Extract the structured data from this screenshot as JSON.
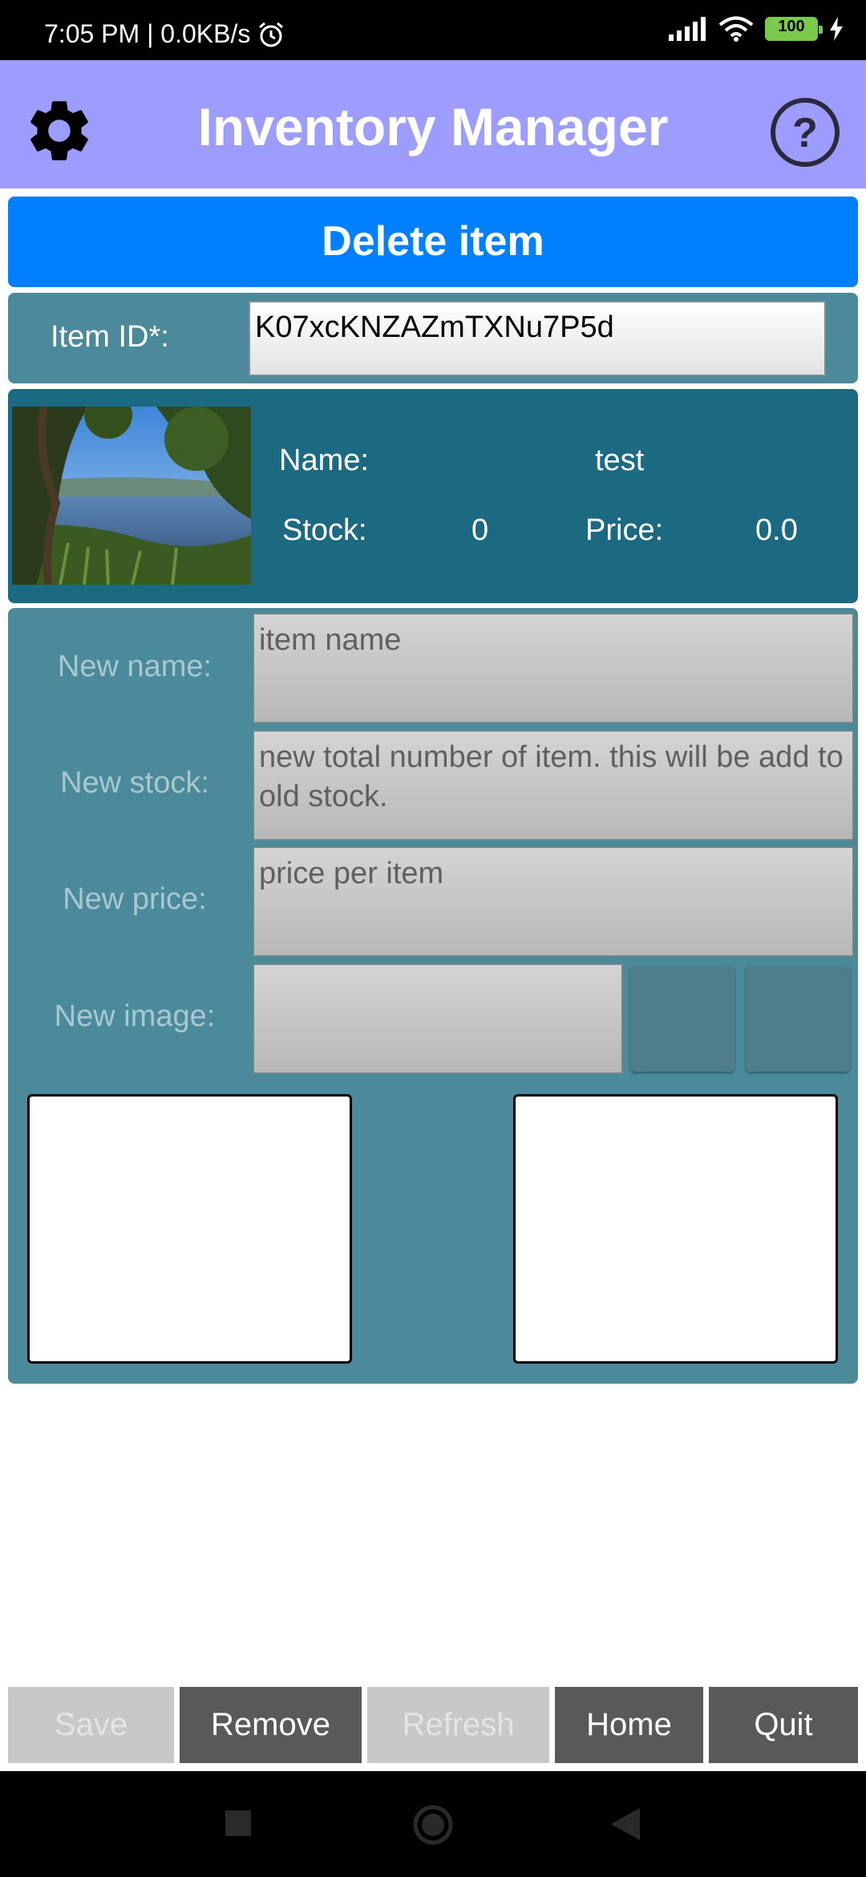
{
  "status_bar": {
    "time_speed": "7:05 PM | 0.0KB/s",
    "battery": "100"
  },
  "header": {
    "title": "Inventory Manager"
  },
  "delete_bar": {
    "label": "Delete item"
  },
  "item_id": {
    "label": "Item ID*:",
    "value": "K07xcKNZAZmTXNu7P5d"
  },
  "item_info": {
    "name_label": "Name:",
    "name_value": "test",
    "stock_label": "Stock:",
    "stock_value": "0",
    "price_label": "Price:",
    "price_value": "0.0"
  },
  "edit": {
    "new_name_label": "New name:",
    "new_name_placeholder": "item name",
    "new_stock_label": "New stock:",
    "new_stock_placeholder": "new total number of item. this will be add to old stock.",
    "new_price_label": "New price:",
    "new_price_placeholder": "price per item",
    "new_image_label": "New image:"
  },
  "buttons": {
    "save": "Save",
    "remove": "Remove",
    "refresh": "Refresh",
    "home": "Home",
    "quit": "Quit"
  },
  "colors": {
    "header": "#9d9dff",
    "delete_bar": "#0080ff",
    "panel": "#4a8a9b",
    "info_panel": "#1c6a82"
  }
}
